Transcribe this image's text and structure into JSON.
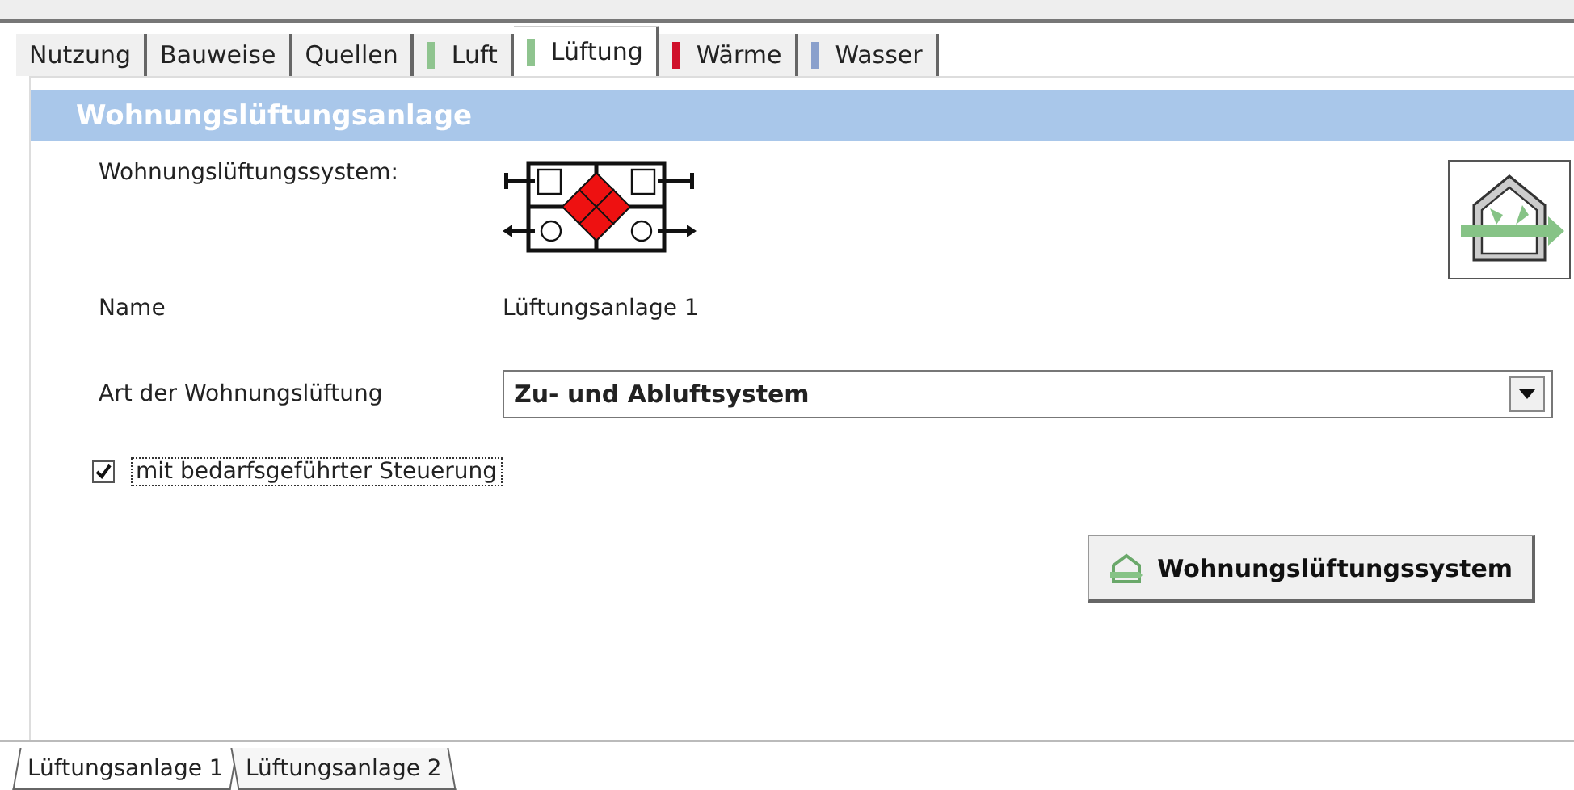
{
  "tabs": [
    {
      "label": "Nutzung",
      "selected": false
    },
    {
      "label": "Bauweise",
      "selected": false
    },
    {
      "label": "Quellen",
      "selected": false
    },
    {
      "label": "Luft",
      "selected": false,
      "color": "#8fc48f"
    },
    {
      "label": "Lüftung",
      "selected": true,
      "color": "#8fc48f"
    },
    {
      "label": "Wärme",
      "selected": false,
      "color": "#d0112b"
    },
    {
      "label": "Wasser",
      "selected": false,
      "color": "#8aa0cc"
    }
  ],
  "section_title": "Wohnungslüftungsanlage",
  "system": {
    "label": "Wohnungslüftungssystem:"
  },
  "name": {
    "label": "Name",
    "value": "Lüftungsanlage 1"
  },
  "type": {
    "label": "Art der Wohnungslüftung",
    "value": "Zu- und Abluftsystem"
  },
  "demand_control": {
    "label": "mit bedarfsgeführter Steuerung",
    "checked": true
  },
  "system_button": {
    "label": "Wohnungslüftungssystem"
  },
  "bottom_tabs": [
    {
      "label": "Lüftungsanlage 1",
      "selected": true
    },
    {
      "label": "Lüftungsanlage 2",
      "selected": false
    }
  ]
}
